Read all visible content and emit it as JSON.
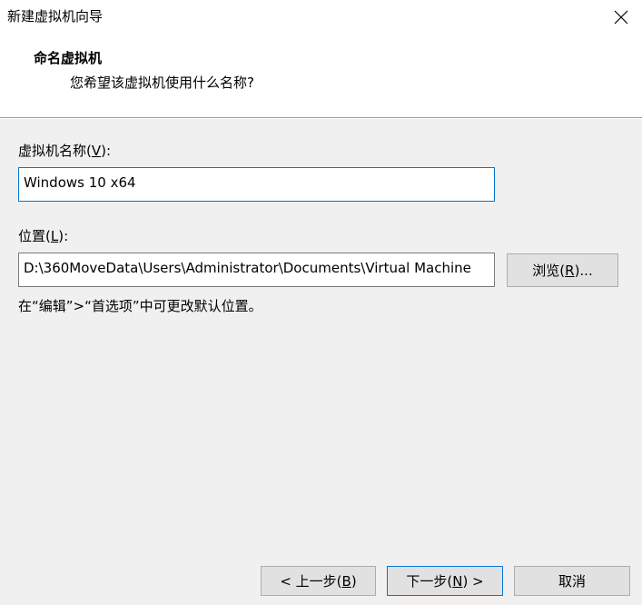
{
  "window": {
    "title": "新建虚拟机向导",
    "close_icon": "close-icon"
  },
  "header": {
    "title": "命名虚拟机",
    "subtitle": "您希望该虚拟机使用什么名称?"
  },
  "vm_name": {
    "label_prefix": "虚拟机名称(",
    "label_mnemonic": "V",
    "label_suffix": "):",
    "value": "Windows 10 x64"
  },
  "location": {
    "label_prefix": "位置(",
    "label_mnemonic": "L",
    "label_suffix": "):",
    "value": "D:\\360MoveData\\Users\\Administrator\\Documents\\Virtual Machine",
    "browse_prefix": "浏览(",
    "browse_mnemonic": "R",
    "browse_suffix": ")...",
    "hint": "在“编辑”>“首选项”中可更改默认位置。"
  },
  "footer": {
    "back_prefix": "< 上一步(",
    "back_mnemonic": "B",
    "back_suffix": ")",
    "next_prefix": "下一步(",
    "next_mnemonic": "N",
    "next_suffix": ") >",
    "cancel_label": "取消"
  },
  "colors": {
    "accent": "#0078d7",
    "button_bg": "#e1e1e1",
    "panel_bg": "#f0f0f0"
  }
}
